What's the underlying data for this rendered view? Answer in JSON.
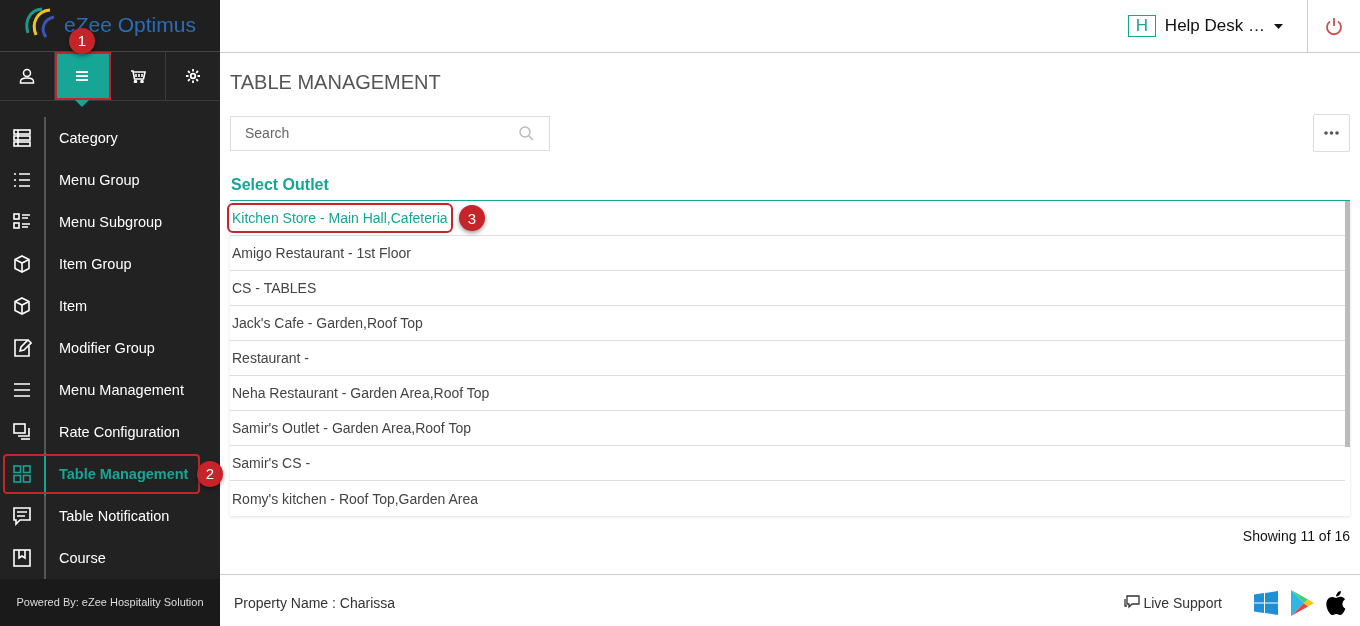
{
  "brand": {
    "name": "eZee Optimus"
  },
  "nav_tabs": [
    {
      "kind": "user",
      "selected": false
    },
    {
      "kind": "menu",
      "selected": true,
      "callout": "1"
    },
    {
      "kind": "cart",
      "selected": false
    },
    {
      "kind": "settings",
      "selected": false
    }
  ],
  "sidebar": {
    "items": [
      {
        "label": "Category",
        "selected": false
      },
      {
        "label": "Menu Group",
        "selected": false
      },
      {
        "label": "Menu Subgroup",
        "selected": false
      },
      {
        "label": "Item Group",
        "selected": false
      },
      {
        "label": "Item",
        "selected": false
      },
      {
        "label": "Modifier Group",
        "selected": false
      },
      {
        "label": "Menu Management",
        "selected": false
      },
      {
        "label": "Rate Configuration",
        "selected": false
      },
      {
        "label": "Table Management",
        "selected": true,
        "callout": "2"
      },
      {
        "label": "Table Notification",
        "selected": false
      },
      {
        "label": "Course",
        "selected": false
      }
    ],
    "powered_by": "Powered By: eZee Hospitality Solution"
  },
  "header": {
    "user_initial": "H",
    "user_name": "Help Desk …"
  },
  "page": {
    "title": "TABLE MANAGEMENT",
    "search": {
      "placeholder": "Search"
    },
    "list_title": "Select Outlet",
    "outlets": [
      {
        "name": "Kitchen Store - Main Hall,Cafeteria",
        "selected": true,
        "callout": "3"
      },
      {
        "name": "Amigo Restaurant - 1st Floor",
        "selected": false
      },
      {
        "name": "CS - TABLES",
        "selected": false
      },
      {
        "name": "Jack's Cafe - Garden,Roof Top",
        "selected": false
      },
      {
        "name": "Restaurant -",
        "selected": false
      },
      {
        "name": "Neha Restaurant - Garden Area,Roof Top",
        "selected": false
      },
      {
        "name": "Samir's Outlet - Garden Area,Roof Top",
        "selected": false
      },
      {
        "name": "Samir's CS -",
        "selected": false
      },
      {
        "name": "Romy's kitchen - Roof Top,Garden Area",
        "selected": false
      }
    ],
    "showing": "Showing 11 of 16"
  },
  "footer": {
    "property": "Property Name : Charissa",
    "live_support": "Live Support"
  }
}
